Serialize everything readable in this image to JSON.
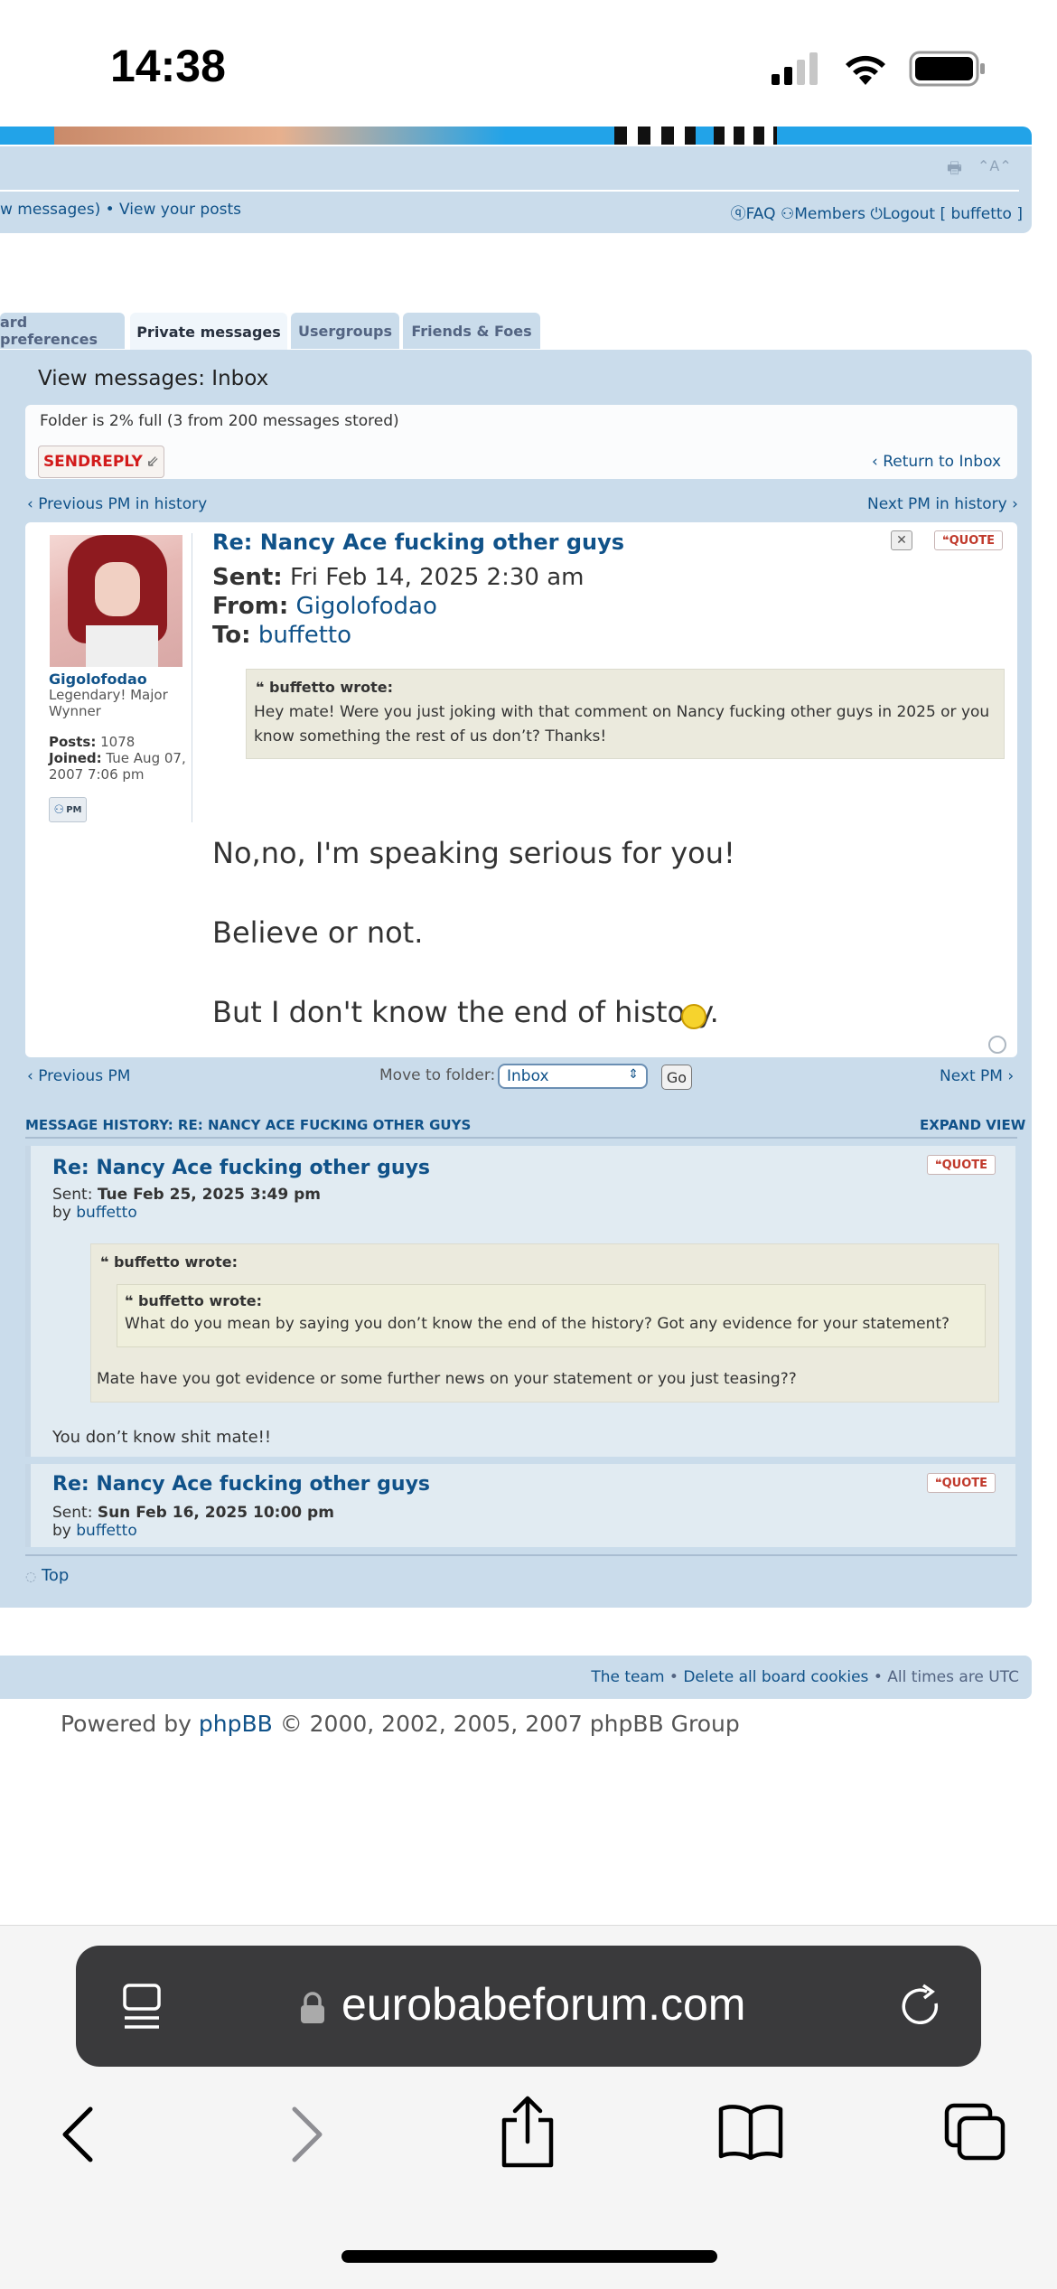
{
  "status_bar": {
    "time": "14:38"
  },
  "header": {
    "nav_left": "w messages) • View your posts",
    "nav_links": {
      "faq": "FAQ",
      "members": "Members",
      "logout": "Logout [ buffetto ]"
    }
  },
  "tabs": [
    {
      "label": "ard preferences"
    },
    {
      "label": "Private messages"
    },
    {
      "label": "Usergroups"
    },
    {
      "label": "Friends & Foes"
    }
  ],
  "panel": {
    "title": "View messages: Inbox",
    "folder_status": "Folder is 2% full (3 from 200 messages stored)",
    "send_reply_label": "SENDREPLY",
    "return_inbox": "Return to Inbox",
    "prev_history": "Previous PM in history",
    "next_history": "Next PM in history"
  },
  "message": {
    "subject": "Re: Nancy Ace fucking other guys",
    "sent_label": "Sent:",
    "sent_value": "Fri Feb 14, 2025 2:30 am",
    "from_label": "From:",
    "from_value": "Gigolofodao",
    "to_label": "To:",
    "to_value": "buffetto",
    "quote_label": "QUOTE",
    "author": {
      "name": "Gigolofodao",
      "rank": "Legendary! Major Wynner",
      "posts_label": "Posts:",
      "posts": "1078",
      "joined_label": "Joined:",
      "joined": "Tue Aug 07, 2007 7:06 pm",
      "pm_label": "PM"
    },
    "quote": {
      "author": "buffetto wrote:",
      "text": "Hey mate! Were you just joking with that comment on Nancy fucking other guys in 2025 or you know something the rest of us don’t? Thanks!"
    },
    "body": [
      "No,no, I'm speaking serious for you!",
      "Believe or not.",
      "But I don't know the end of history."
    ]
  },
  "pm_nav": {
    "prev": "Previous PM",
    "move_label": "Move to folder:",
    "folder_selected": "Inbox",
    "go": "Go",
    "next": "Next PM"
  },
  "history": {
    "heading": "MESSAGE HISTORY: RE: NANCY ACE FUCKING OTHER GUYS",
    "expand": "EXPAND VIEW",
    "items": [
      {
        "subject": "Re: Nancy Ace fucking other guys",
        "sent_label": "Sent:",
        "sent": "Tue Feb 25, 2025 3:49 pm",
        "by_label": "by",
        "by": "buffetto",
        "outer_quote_author": "buffetto wrote:",
        "inner_quote_author": "buffetto wrote:",
        "inner_quote_text": "What do you mean by saying you don’t know the end of the history? Got any evidence for your statement?",
        "outer_quote_text": "Mate have you got evidence or some further news on your statement or you just teasing??",
        "body": "You don’t know shit mate!!"
      },
      {
        "subject": "Re: Nancy Ace fucking other guys",
        "sent_label": "Sent:",
        "sent": "Sun Feb 16, 2025 10:00 pm",
        "by_label": "by",
        "by": "buffetto"
      }
    ],
    "top": "Top"
  },
  "footer": {
    "team": "The team",
    "delete_cookies": "Delete all board cookies",
    "times": "All times are UTC",
    "powered_prefix": "Powered by",
    "phpbb": "phpBB",
    "powered_suffix": "© 2000, 2002, 2005, 2007 phpBB Group"
  },
  "browser": {
    "url": "eurobabeforum.com"
  }
}
